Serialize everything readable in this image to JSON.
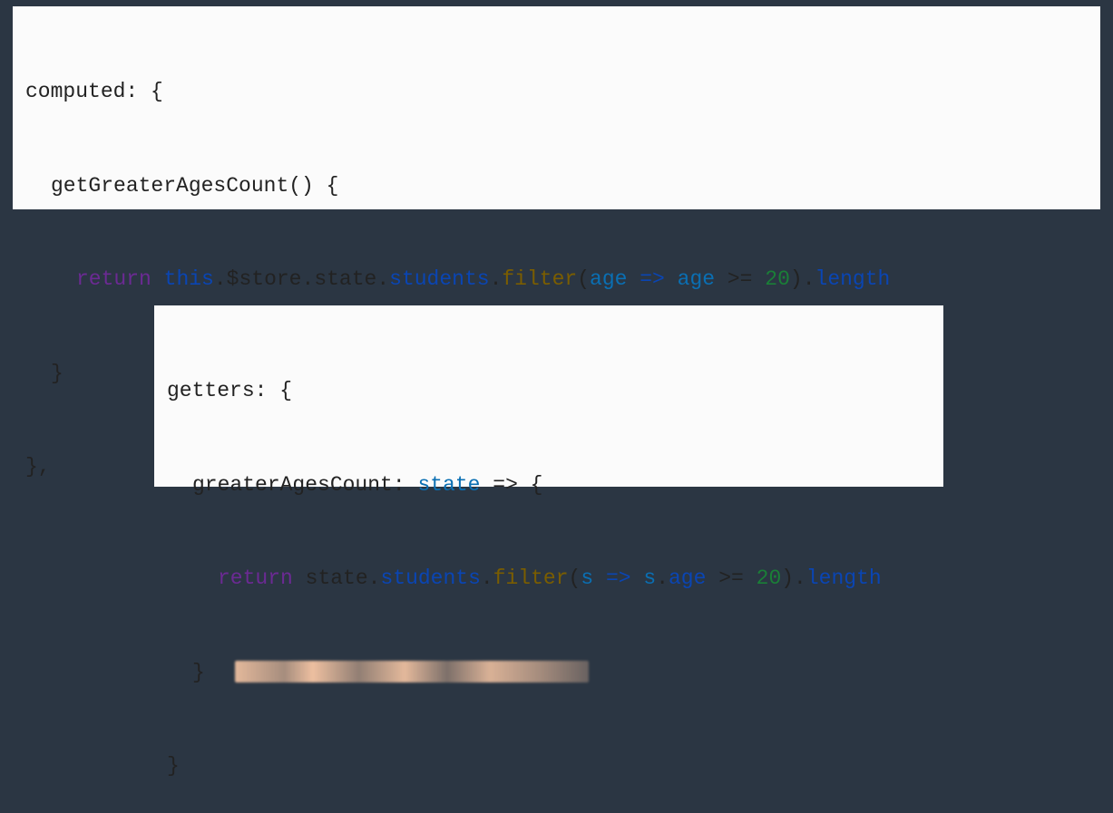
{
  "block1": {
    "l1": {
      "t1": "computed",
      "t2": ": {"
    },
    "l2": {
      "t1": "getGreaterAgesCount",
      "t2": "() {"
    },
    "l3": {
      "ret": "return",
      "sp": " ",
      "this": "this",
      "dot1": ".",
      "store": "$store",
      "dot2": ".",
      "state": "state",
      "dot3": ".",
      "students": "students",
      "dot4": ".",
      "filter": "filter",
      "op": "(",
      "arg": "age",
      "arr": " => ",
      "arg2": "age",
      "cmp": " >= ",
      "num": "20",
      "cp": ").",
      "length": "length"
    },
    "l4": "}",
    "l5": "},"
  },
  "block2": {
    "l1": {
      "t1": "getters",
      "t2": ": {"
    },
    "l2": {
      "t1": "greaterAgesCount",
      "t2": ": ",
      "t3": "state",
      "t4": " => {"
    },
    "l3": {
      "ret": "return",
      "sp": " ",
      "state": "state",
      "dot1": ".",
      "students": "students",
      "dot2": ".",
      "filter": "filter",
      "op": "(",
      "arg": "s",
      "arr": " => ",
      "arg2": "s",
      "dot3": ".",
      "ageprop": "age",
      "cmp": " >= ",
      "num": "20",
      "cp": ").",
      "length": "length"
    },
    "l4": "}",
    "l5": "}"
  }
}
